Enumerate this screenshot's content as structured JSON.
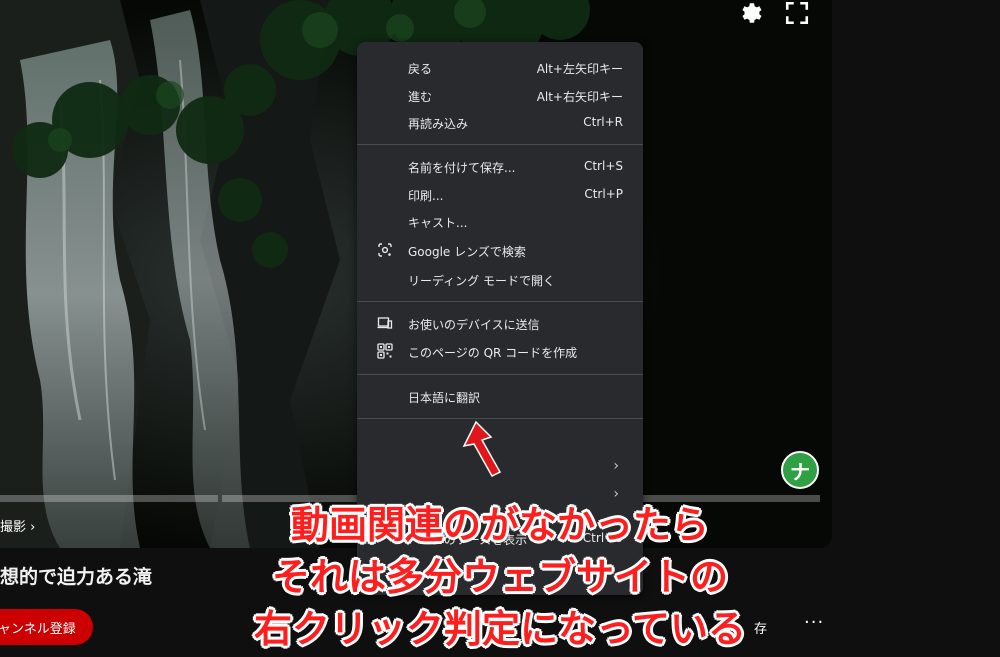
{
  "video": {
    "chapter_label": "撮影 ›",
    "title": "想的で迫力ある滝",
    "subscribe_label": "ャンネル登録",
    "save_label": "存",
    "more_label": "···",
    "avatar_letter": "ナ"
  },
  "context_menu": {
    "items": [
      {
        "label": "戻る",
        "shortcut": "Alt+左矢印キー"
      },
      {
        "label": "進む",
        "shortcut": "Alt+右矢印キー"
      },
      {
        "label": "再読み込み",
        "shortcut": "Ctrl+R"
      },
      {
        "label": "名前を付けて保存...",
        "shortcut": "Ctrl+S"
      },
      {
        "label": "印刷...",
        "shortcut": "Ctrl+P"
      },
      {
        "label": "キャスト...",
        "shortcut": ""
      },
      {
        "label": "Google レンズで検索",
        "shortcut": "",
        "icon": "lens-icon"
      },
      {
        "label": "リーディング モードで開く",
        "shortcut": ""
      },
      {
        "label": "お使いのデバイスに送信",
        "shortcut": "",
        "icon": "device-icon"
      },
      {
        "label": "このページの QR コードを作成",
        "shortcut": "",
        "icon": "qr-code-icon"
      },
      {
        "label": "日本語に翻訳",
        "shortcut": ""
      },
      {
        "label": "ページのソースを表示",
        "shortcut": "Ctrl+U"
      }
    ]
  },
  "overlay_text": {
    "line1": "動画関連のがなかったら",
    "line2": "それは多分ウェブサイトの",
    "line3": "右クリック判定になっている"
  },
  "colors": {
    "menu_bg": "#292a2d",
    "overlay_red": "#ff1e1e",
    "subscribe_red": "#cc0000",
    "avatar_green": "#2fa043"
  }
}
